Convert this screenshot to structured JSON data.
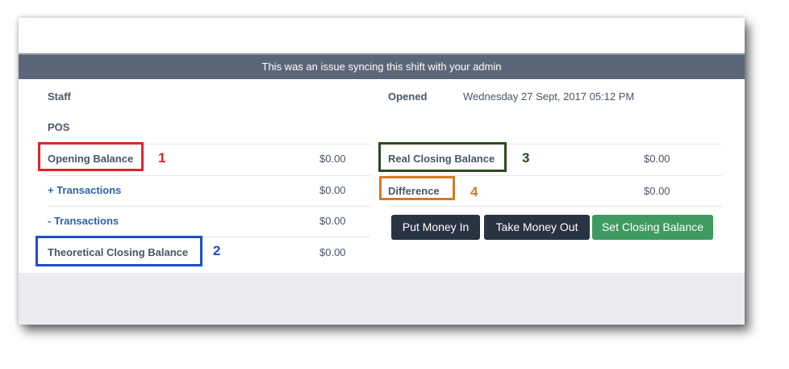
{
  "banner": {
    "message": "This was an issue syncing this shift with your admin"
  },
  "left": {
    "staff_label": "Staff",
    "pos_label": "POS",
    "opening_balance": {
      "label": "Opening Balance",
      "value": "$0.00"
    },
    "plus_transactions": {
      "label": "+ Transactions",
      "value": "$0.00"
    },
    "minus_transactions": {
      "label": "- Transactions",
      "value": "$0.00"
    },
    "theoretical_closing_balance": {
      "label": "Theoretical Closing Balance",
      "value": "$0.00"
    }
  },
  "right": {
    "opened": {
      "label": "Opened",
      "value": "Wednesday 27 Sept, 2017 05:12 PM"
    },
    "real_closing_balance": {
      "label": "Real Closing Balance",
      "value": "$0.00"
    },
    "difference": {
      "label": "Difference",
      "value": "$0.00"
    }
  },
  "buttons": {
    "put_money_in": "Put Money In",
    "take_money_out": "Take Money Out",
    "set_closing_balance": "Set Closing Balance"
  },
  "annotations": [
    {
      "number": "1",
      "color": "#e0242d"
    },
    {
      "number": "2",
      "color": "#1f4fc4"
    },
    {
      "number": "3",
      "color": "#2e4a1e"
    },
    {
      "number": "4",
      "color": "#d27b28"
    }
  ],
  "colors": {
    "banner": "#5b6778",
    "dark_button": "#283343",
    "green_button": "#3f9a62",
    "link": "#2c64a8"
  }
}
